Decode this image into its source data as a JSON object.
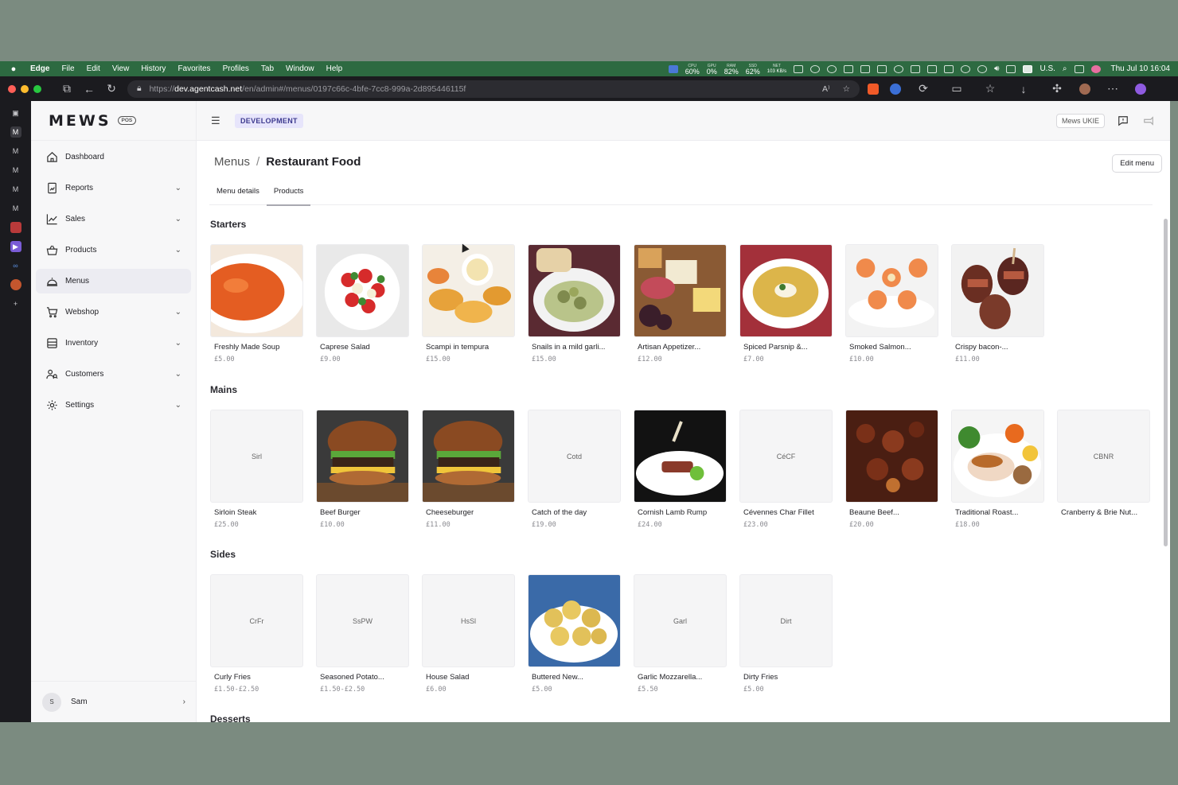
{
  "menubar": {
    "apps": [
      "Edge",
      "File",
      "Edit",
      "View",
      "History",
      "Favorites",
      "Profiles",
      "Tab",
      "Window",
      "Help"
    ],
    "stats": [
      {
        "label": "CPU",
        "value": "60%"
      },
      {
        "label": "GPU",
        "value": "0%"
      },
      {
        "label": "RAM",
        "value": "82%"
      },
      {
        "label": "SSD",
        "value": "62%"
      },
      {
        "label": "NET",
        "value": "103 KB/s"
      }
    ],
    "keyboard": "U.S.",
    "clock": "Thu Jul 10  16:04"
  },
  "browser": {
    "url_prefix": "https://",
    "url_host": "dev.agentcash.net",
    "url_path": "/en/admin#/menus/0197c66c-4bfe-7cc8-999a-2d895446115f"
  },
  "edge_sidebar": {
    "icons": [
      "tabs-icon",
      "mews-tab-icon"
    ]
  },
  "sidebar": {
    "logo": "MEWS",
    "logo_badge": "POS",
    "items": [
      {
        "label": "Dashboard",
        "icon": "home-icon",
        "expandable": false
      },
      {
        "label": "Reports",
        "icon": "report-icon",
        "expandable": true
      },
      {
        "label": "Sales",
        "icon": "chart-icon",
        "expandable": true
      },
      {
        "label": "Products",
        "icon": "basket-icon",
        "expandable": true
      },
      {
        "label": "Menus",
        "icon": "cloche-icon",
        "expandable": false,
        "active": true
      },
      {
        "label": "Webshop",
        "icon": "cart-icon",
        "expandable": true
      },
      {
        "label": "Inventory",
        "icon": "inventory-icon",
        "expandable": true
      },
      {
        "label": "Customers",
        "icon": "customers-icon",
        "expandable": true
      },
      {
        "label": "Settings",
        "icon": "gear-icon",
        "expandable": true
      }
    ],
    "user": {
      "initial": "S",
      "name": "Sam"
    }
  },
  "topbar": {
    "environment": "DEVELOPMENT",
    "enterprise": "Mews UKIE"
  },
  "main": {
    "breadcrumb_parent": "Menus",
    "breadcrumb_sep": "/",
    "title": "Restaurant Food",
    "edit_button": "Edit menu",
    "tabs": [
      {
        "label": "Menu details"
      },
      {
        "label": "Products",
        "active": true
      }
    ],
    "sections": [
      {
        "title": "Starters",
        "products": [
          {
            "name": "Freshly Made Soup",
            "price": "£5.00",
            "image": "soup"
          },
          {
            "name": "Caprese Salad",
            "price": "£9.00",
            "image": "caprese"
          },
          {
            "name": "Scampi in tempura",
            "price": "£15.00",
            "image": "scampi"
          },
          {
            "name": "Snails in a mild garli...",
            "price": "£15.00",
            "image": "snails"
          },
          {
            "name": "Artisan Appetizer...",
            "price": "£12.00",
            "image": "board"
          },
          {
            "name": "Spiced Parsnip &...",
            "price": "£7.00",
            "image": "parsnip"
          },
          {
            "name": "Smoked Salmon...",
            "price": "£10.00",
            "image": "salmon"
          },
          {
            "name": "Crispy bacon-...",
            "price": "£11.00",
            "image": "bacon"
          }
        ]
      },
      {
        "title": "Mains",
        "products": [
          {
            "name": "Sirloin Steak",
            "price": "£25.00",
            "placeholder": "Sirl"
          },
          {
            "name": "Beef Burger",
            "price": "£10.00",
            "image": "burger"
          },
          {
            "name": "Cheeseburger",
            "price": "£11.00",
            "image": "burger"
          },
          {
            "name": "Catch of the day",
            "price": "£19.00",
            "placeholder": "Cotd"
          },
          {
            "name": "Cornish Lamb Rump",
            "price": "£24.00",
            "image": "lamb"
          },
          {
            "name": "Cévennes Char Fillet",
            "price": "£23.00",
            "placeholder": "CéCF"
          },
          {
            "name": "Beaune Beef...",
            "price": "£20.00",
            "image": "stew"
          },
          {
            "name": "Traditional Roast...",
            "price": "£18.00",
            "image": "roast"
          },
          {
            "name": "Cranberry & Brie Nut...",
            "price": "",
            "placeholder": "CBNR"
          }
        ]
      },
      {
        "title": "Sides",
        "products": [
          {
            "name": "Curly Fries",
            "price": "£1.50-£2.50",
            "placeholder": "CrFr"
          },
          {
            "name": "Seasoned Potato...",
            "price": "£1.50-£2.50",
            "placeholder": "SsPW"
          },
          {
            "name": "House Salad",
            "price": "£6.00",
            "placeholder": "HsSl"
          },
          {
            "name": "Buttered New...",
            "price": "£5.00",
            "image": "potatoes"
          },
          {
            "name": "Garlic Mozzarella...",
            "price": "£5.50",
            "placeholder": "Garl"
          },
          {
            "name": "Dirty Fries",
            "price": "£5.00",
            "placeholder": "Dirt"
          }
        ]
      },
      {
        "title": "Desserts",
        "products": []
      }
    ]
  },
  "colors": {
    "menubar": "#2d6a41",
    "dev_badge_bg": "#e7e5fb",
    "dev_badge_text": "#3d3a8f",
    "sidebar_bg": "#f7f7f8"
  }
}
